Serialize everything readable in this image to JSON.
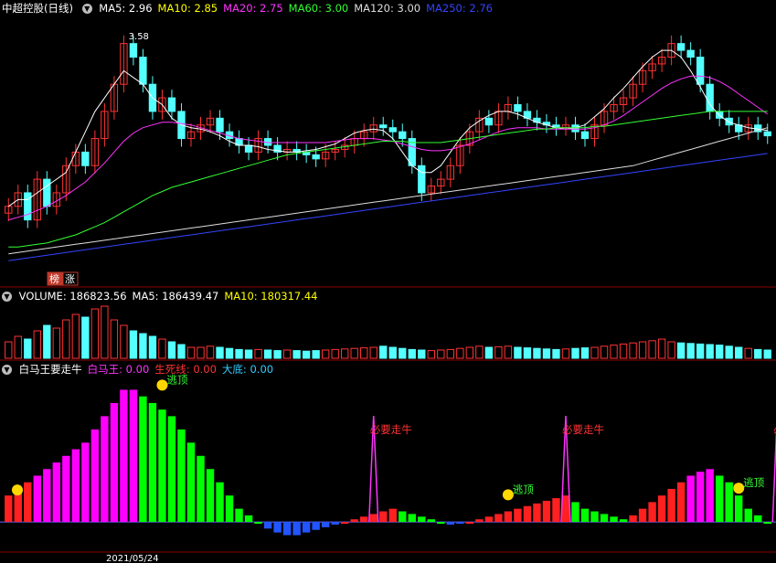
{
  "panels": {
    "price": {
      "title": "中超控股(日线)",
      "ma_labels": [
        {
          "text": "MA5: 2.96",
          "color": "#ffffff"
        },
        {
          "text": "MA10: 2.85",
          "color": "#ffff00"
        },
        {
          "text": "MA20: 2.75",
          "color": "#ff33ff"
        },
        {
          "text": "MA60: 3.00",
          "color": "#33ff33"
        },
        {
          "text": "MA120: 3.00",
          "color": "#dddddd"
        },
        {
          "text": "MA250: 2.76",
          "color": "#3344ff"
        }
      ],
      "high_label": "3.58",
      "badges": [
        "榜",
        "涨"
      ]
    },
    "volume": {
      "labels": [
        {
          "text": "VOLUME: 186823.56",
          "color": "#ffffff"
        },
        {
          "text": "MA5: 186439.47",
          "color": "#ffffff"
        },
        {
          "text": "MA10: 180317.44",
          "color": "#ffff00"
        }
      ]
    },
    "indicator": {
      "labels": [
        {
          "text": "白马王要走牛",
          "color": "#ffffff"
        },
        {
          "text": "白马王: 0.00",
          "color": "#ff33ff"
        },
        {
          "text": "生死线: 0.00",
          "color": "#ff3333"
        },
        {
          "text": "大底: 0.00",
          "color": "#33ccff"
        }
      ],
      "escape_label": "逃顶",
      "bull_label": "必要走牛"
    },
    "axis_date": "2021/05/24"
  },
  "chart_data": [
    {
      "type": "candlestick",
      "series": [
        {
          "name": "MA5",
          "color": "#ffffff"
        },
        {
          "name": "MA10",
          "color": "#ffff00"
        },
        {
          "name": "MA20",
          "color": "#ff33ff"
        },
        {
          "name": "MA60",
          "color": "#33ff33"
        },
        {
          "name": "MA120",
          "color": "#dddddd"
        },
        {
          "name": "MA250",
          "color": "#3344ff"
        }
      ],
      "ylim": [
        1.8,
        3.7
      ],
      "close": [
        2.3,
        2.4,
        2.2,
        2.5,
        2.3,
        2.4,
        2.6,
        2.7,
        2.6,
        2.8,
        3.0,
        3.2,
        3.5,
        3.4,
        3.2,
        3.0,
        3.1,
        3.0,
        2.8,
        2.85,
        2.9,
        2.95,
        2.85,
        2.8,
        2.75,
        2.7,
        2.8,
        2.75,
        2.7,
        2.72,
        2.7,
        2.68,
        2.65,
        2.7,
        2.72,
        2.75,
        2.8,
        2.85,
        2.9,
        2.88,
        2.85,
        2.8,
        2.6,
        2.4,
        2.45,
        2.5,
        2.6,
        2.75,
        2.85,
        2.95,
        2.9,
        3.0,
        3.05,
        3.0,
        2.95,
        2.92,
        2.9,
        2.88,
        2.9,
        2.85,
        2.8,
        2.9,
        3.0,
        3.05,
        3.1,
        3.2,
        3.3,
        3.35,
        3.4,
        3.5,
        3.45,
        3.4,
        3.2,
        3.0,
        2.95,
        2.9,
        2.85,
        2.9,
        2.85,
        2.82
      ],
      "ma5": [
        2.3,
        2.35,
        2.35,
        2.4,
        2.45,
        2.5,
        2.55,
        2.7,
        2.85,
        3.0,
        3.1,
        3.2,
        3.3,
        3.25,
        3.2,
        3.1,
        3.05,
        2.95,
        2.9,
        2.88,
        2.87,
        2.85,
        2.82,
        2.78,
        2.75,
        2.75,
        2.74,
        2.72,
        2.71,
        2.7,
        2.7,
        2.71,
        2.72,
        2.74,
        2.76,
        2.8,
        2.84,
        2.86,
        2.87,
        2.86,
        2.8,
        2.7,
        2.6,
        2.55,
        2.55,
        2.6,
        2.7,
        2.8,
        2.88,
        2.93,
        2.97,
        3.0,
        3.0,
        2.98,
        2.95,
        2.92,
        2.9,
        2.88,
        2.87,
        2.88,
        2.9,
        2.96,
        3.02,
        3.1,
        3.17,
        3.25,
        3.33,
        3.4,
        3.45,
        3.45,
        3.4,
        3.3,
        3.18,
        3.05,
        2.97,
        2.92,
        2.9,
        2.88,
        2.87,
        2.86
      ],
      "ma20": [
        2.2,
        2.22,
        2.24,
        2.27,
        2.3,
        2.34,
        2.38,
        2.43,
        2.48,
        2.55,
        2.62,
        2.7,
        2.78,
        2.84,
        2.88,
        2.9,
        2.92,
        2.92,
        2.91,
        2.9,
        2.88,
        2.86,
        2.84,
        2.82,
        2.8,
        2.79,
        2.78,
        2.77,
        2.77,
        2.77,
        2.77,
        2.77,
        2.77,
        2.77,
        2.78,
        2.79,
        2.8,
        2.8,
        2.8,
        2.79,
        2.78,
        2.76,
        2.74,
        2.72,
        2.71,
        2.71,
        2.72,
        2.74,
        2.76,
        2.79,
        2.82,
        2.85,
        2.87,
        2.88,
        2.88,
        2.88,
        2.87,
        2.87,
        2.87,
        2.87,
        2.87,
        2.88,
        2.9,
        2.93,
        2.97,
        3.02,
        3.07,
        3.12,
        3.17,
        3.21,
        3.24,
        3.26,
        3.26,
        3.25,
        3.22,
        3.18,
        3.13,
        3.08,
        3.03,
        2.98
      ],
      "ma60": [
        2.0,
        2.0,
        2.01,
        2.02,
        2.03,
        2.05,
        2.07,
        2.09,
        2.12,
        2.15,
        2.18,
        2.22,
        2.26,
        2.3,
        2.34,
        2.38,
        2.41,
        2.44,
        2.46,
        2.48,
        2.5,
        2.52,
        2.54,
        2.56,
        2.58,
        2.6,
        2.62,
        2.64,
        2.66,
        2.68,
        2.69,
        2.7,
        2.71,
        2.72,
        2.73,
        2.74,
        2.75,
        2.76,
        2.77,
        2.78,
        2.78,
        2.78,
        2.77,
        2.77,
        2.77,
        2.77,
        2.78,
        2.79,
        2.8,
        2.81,
        2.82,
        2.83,
        2.84,
        2.85,
        2.86,
        2.87,
        2.87,
        2.88,
        2.88,
        2.88,
        2.88,
        2.89,
        2.89,
        2.9,
        2.91,
        2.92,
        2.93,
        2.94,
        2.95,
        2.96,
        2.97,
        2.98,
        2.99,
        3.0,
        3.0,
        3.0,
        3.0,
        3.0,
        3.0,
        3.0
      ],
      "ma120": [
        1.95,
        1.96,
        1.97,
        1.98,
        1.99,
        2.0,
        2.01,
        2.02,
        2.03,
        2.04,
        2.05,
        2.06,
        2.07,
        2.08,
        2.09,
        2.1,
        2.11,
        2.12,
        2.13,
        2.14,
        2.15,
        2.16,
        2.17,
        2.18,
        2.19,
        2.2,
        2.21,
        2.22,
        2.23,
        2.24,
        2.25,
        2.26,
        2.27,
        2.28,
        2.29,
        2.3,
        2.31,
        2.32,
        2.33,
        2.34,
        2.35,
        2.36,
        2.37,
        2.38,
        2.39,
        2.4,
        2.41,
        2.42,
        2.43,
        2.44,
        2.45,
        2.46,
        2.47,
        2.48,
        2.49,
        2.5,
        2.51,
        2.52,
        2.53,
        2.54,
        2.55,
        2.56,
        2.57,
        2.58,
        2.59,
        2.6,
        2.62,
        2.64,
        2.66,
        2.68,
        2.7,
        2.72,
        2.74,
        2.76,
        2.78,
        2.8,
        2.82,
        2.84,
        2.86,
        2.88
      ],
      "ma250": [
        1.9,
        1.91,
        1.92,
        1.93,
        1.94,
        1.95,
        1.96,
        1.97,
        1.98,
        1.99,
        2.0,
        2.01,
        2.02,
        2.03,
        2.04,
        2.05,
        2.06,
        2.07,
        2.08,
        2.09,
        2.1,
        2.11,
        2.12,
        2.13,
        2.14,
        2.15,
        2.16,
        2.17,
        2.18,
        2.19,
        2.2,
        2.21,
        2.22,
        2.23,
        2.24,
        2.25,
        2.26,
        2.27,
        2.28,
        2.29,
        2.3,
        2.31,
        2.32,
        2.33,
        2.34,
        2.35,
        2.36,
        2.37,
        2.38,
        2.39,
        2.4,
        2.41,
        2.42,
        2.43,
        2.44,
        2.45,
        2.46,
        2.47,
        2.48,
        2.49,
        2.5,
        2.51,
        2.52,
        2.53,
        2.54,
        2.55,
        2.56,
        2.57,
        2.58,
        2.59,
        2.6,
        2.61,
        2.62,
        2.63,
        2.64,
        2.65,
        2.66,
        2.67,
        2.68,
        2.69
      ]
    },
    {
      "type": "bar",
      "values": [
        0.3,
        0.4,
        0.35,
        0.5,
        0.6,
        0.55,
        0.7,
        0.8,
        0.75,
        0.9,
        0.95,
        0.7,
        0.6,
        0.5,
        0.45,
        0.4,
        0.35,
        0.3,
        0.25,
        0.2,
        0.2,
        0.22,
        0.2,
        0.18,
        0.16,
        0.15,
        0.16,
        0.15,
        0.14,
        0.15,
        0.14,
        0.13,
        0.14,
        0.15,
        0.16,
        0.17,
        0.18,
        0.19,
        0.2,
        0.22,
        0.2,
        0.18,
        0.16,
        0.15,
        0.14,
        0.15,
        0.16,
        0.18,
        0.2,
        0.22,
        0.2,
        0.21,
        0.22,
        0.2,
        0.19,
        0.18,
        0.17,
        0.16,
        0.17,
        0.18,
        0.19,
        0.2,
        0.22,
        0.24,
        0.26,
        0.28,
        0.3,
        0.32,
        0.35,
        0.3,
        0.28,
        0.27,
        0.26,
        0.25,
        0.24,
        0.22,
        0.2,
        0.18,
        0.16,
        0.15
      ],
      "ylim": [
        0,
        1
      ]
    },
    {
      "type": "bar",
      "values": [
        0.2,
        0.25,
        0.3,
        0.35,
        0.4,
        0.45,
        0.5,
        0.55,
        0.6,
        0.7,
        0.8,
        0.9,
        1.0,
        1.0,
        0.95,
        0.9,
        0.85,
        0.8,
        0.7,
        0.6,
        0.5,
        0.4,
        0.3,
        0.2,
        0.1,
        0.05,
        0.0,
        -0.05,
        -0.08,
        -0.1,
        -0.1,
        -0.08,
        -0.06,
        -0.04,
        -0.02,
        0.0,
        0.02,
        0.04,
        0.06,
        0.08,
        0.1,
        0.08,
        0.06,
        0.04,
        0.02,
        0.0,
        -0.02,
        -0.01,
        0.0,
        0.02,
        0.04,
        0.06,
        0.08,
        0.1,
        0.12,
        0.14,
        0.16,
        0.18,
        0.2,
        0.15,
        0.1,
        0.08,
        0.06,
        0.04,
        0.02,
        0.05,
        0.1,
        0.15,
        0.2,
        0.25,
        0.3,
        0.35,
        0.38,
        0.4,
        0.35,
        0.3,
        0.2,
        0.1,
        0.05,
        0.0
      ],
      "ylim": [
        -0.2,
        1.1
      ]
    }
  ]
}
